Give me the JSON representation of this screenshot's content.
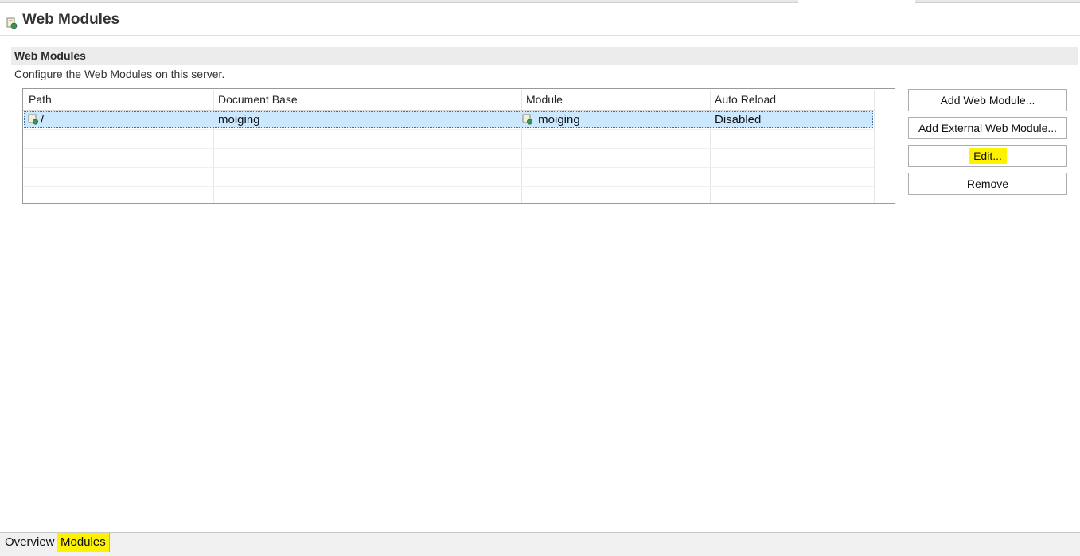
{
  "header": {
    "title": "Web Modules",
    "icon": "web-module-icon"
  },
  "section": {
    "title": "Web Modules",
    "description": "Configure the Web Modules on this server."
  },
  "table": {
    "columns": [
      "Path",
      "Document Base",
      "Module",
      "Auto Reload"
    ],
    "rows": [
      {
        "path": "/",
        "document_base": "moiging",
        "module": "moiging",
        "auto_reload": "Disabled"
      }
    ]
  },
  "buttons": {
    "add_web_module": "Add Web Module...",
    "add_external_web_module": "Add External Web Module...",
    "edit": "Edit...",
    "remove": "Remove"
  },
  "tabs": {
    "overview": "Overview",
    "modules": "Modules"
  },
  "colors": {
    "highlight": "#fff200",
    "selection": "#cce8ff"
  }
}
